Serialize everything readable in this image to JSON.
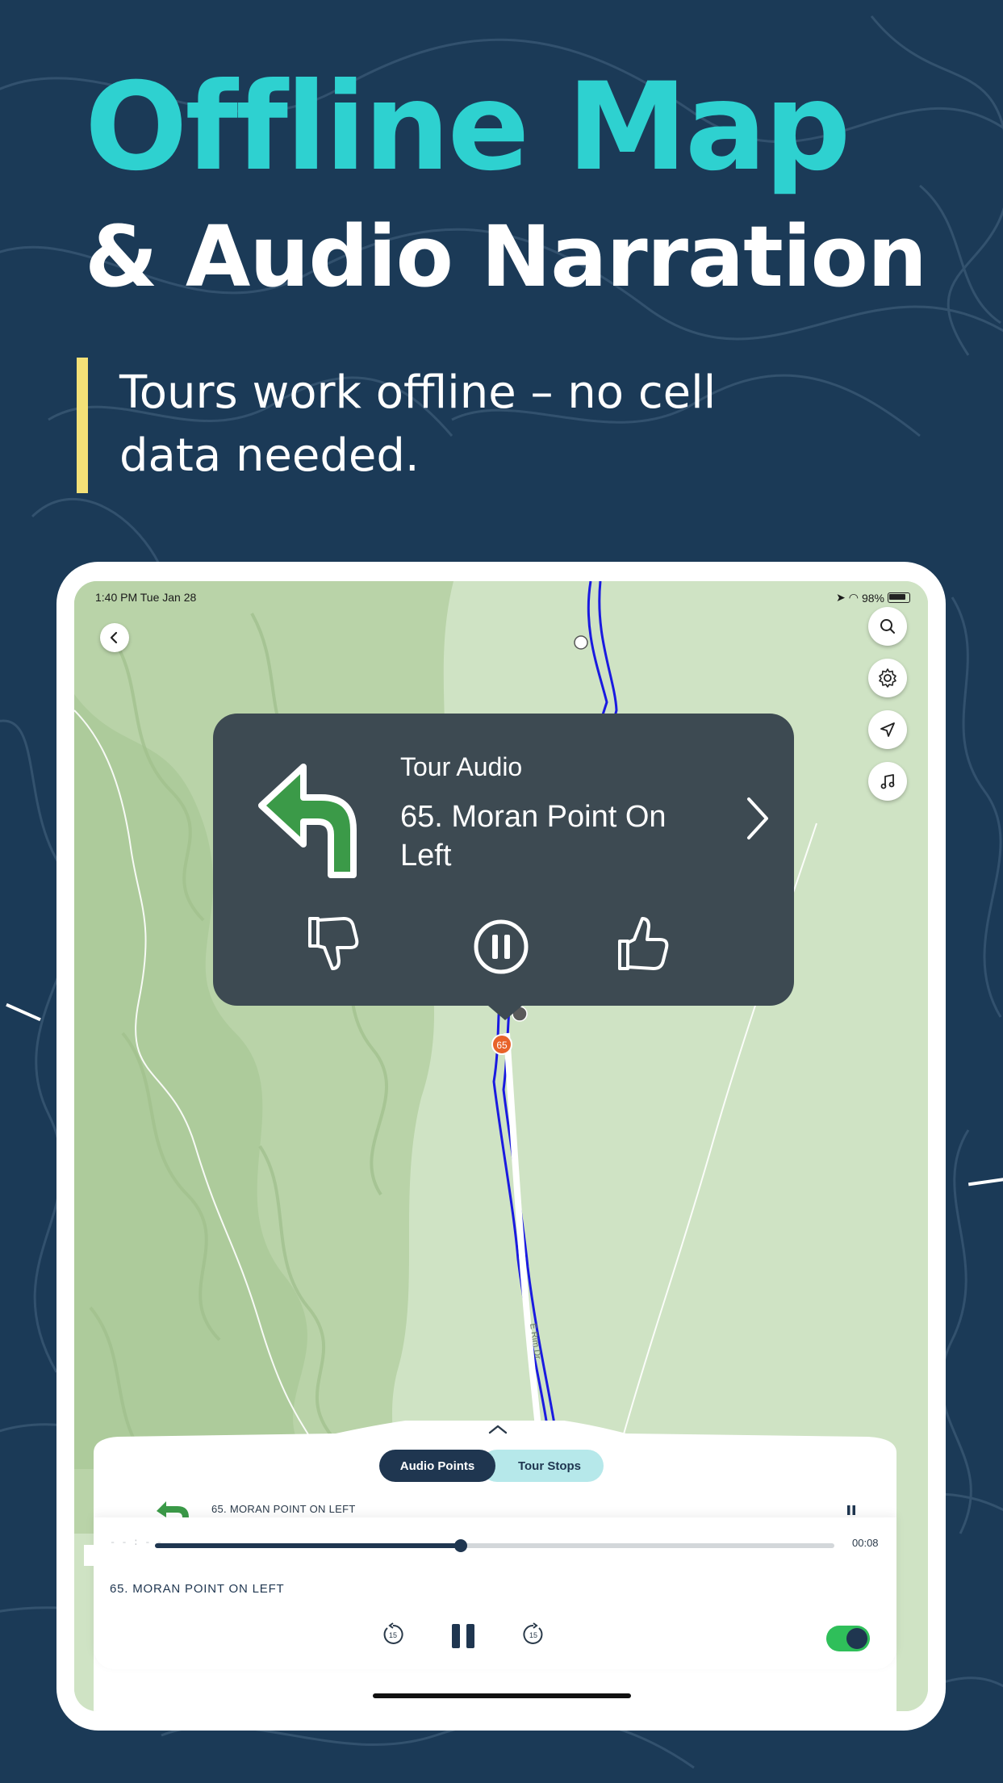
{
  "headline": {
    "line1": "Offline Map",
    "line2": "& Audio Narration",
    "subtitle": "Tours work offline – no cell data needed."
  },
  "colors": {
    "background": "#1b3a57",
    "accent_teal": "#2ed1d0",
    "accent_yellow": "#f3e077",
    "map_green": "#cfe3c4",
    "route_blue": "#1a1ae0",
    "popup_bg": "#3d4a52",
    "stop_marker": "#e8632a",
    "toggle_on": "#2fbf5a"
  },
  "status_bar": {
    "time": "1:40 PM   Tue Jan 28",
    "battery": "98%"
  },
  "map": {
    "back_icon": "chevron-left-icon",
    "controls": [
      "search-icon",
      "gear-icon",
      "location-arrow-icon",
      "music-note-icon"
    ],
    "road_label": "E Rim Dr",
    "current_stop_marker": "65"
  },
  "popup": {
    "label": "Tour Audio",
    "title": "65. Moran Point On Left",
    "direction_icon": "turn-left-arrow-icon"
  },
  "sheet": {
    "tabs": [
      "Audio Points",
      "Tour Stops"
    ],
    "active_tab": "Audio Points",
    "row_title": "65. MORAN POINT ON LEFT"
  },
  "player": {
    "remaining": "- - : - -",
    "elapsed": "00:08",
    "progress": 0.45,
    "title": "65. MORAN POINT ON LEFT",
    "skip_seconds": "15",
    "autoplay_on": true
  }
}
